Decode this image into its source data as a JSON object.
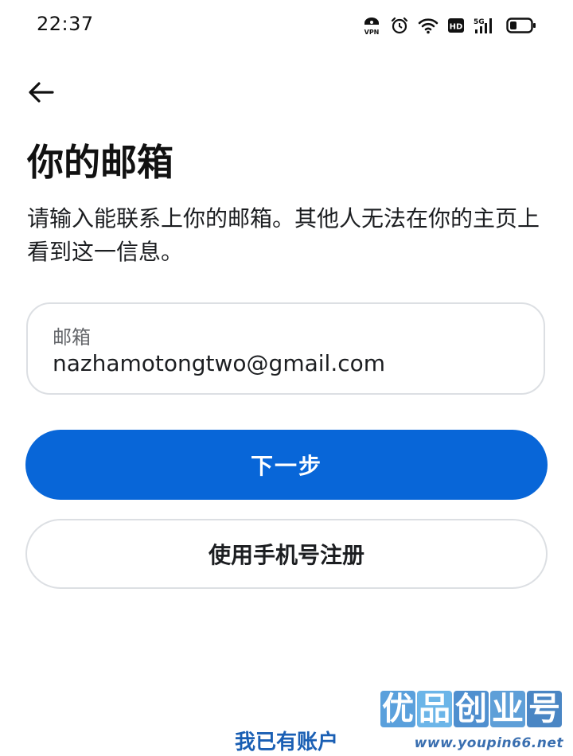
{
  "status_bar": {
    "time": "22:37",
    "vpn_label": "VPN",
    "hd_label": "HD",
    "network_label": "5G",
    "icons": [
      "vpn-icon",
      "alarm-icon",
      "wifi-icon",
      "hd-icon",
      "signal-5g-icon",
      "battery-icon"
    ]
  },
  "header": {
    "back_icon": "arrow-left-icon"
  },
  "main": {
    "title": "你的邮箱",
    "description": "请输入能联系上你的邮箱。其他人无法在你的主页上看到这一信息。",
    "email_field": {
      "label": "邮箱",
      "value": "nazhamotongtwo@gmail.com"
    },
    "next_button": "下一步",
    "phone_signup_button": "使用手机号注册",
    "login_link": "我已有账户"
  },
  "watermark": {
    "logo_chars": [
      "优",
      "品",
      "创",
      "业",
      "号"
    ],
    "url": "www.youpin66.net"
  },
  "colors": {
    "primary": "#0866d8",
    "link": "#1a5fb4",
    "border": "#dcdfe3",
    "text": "#1c1e21"
  }
}
